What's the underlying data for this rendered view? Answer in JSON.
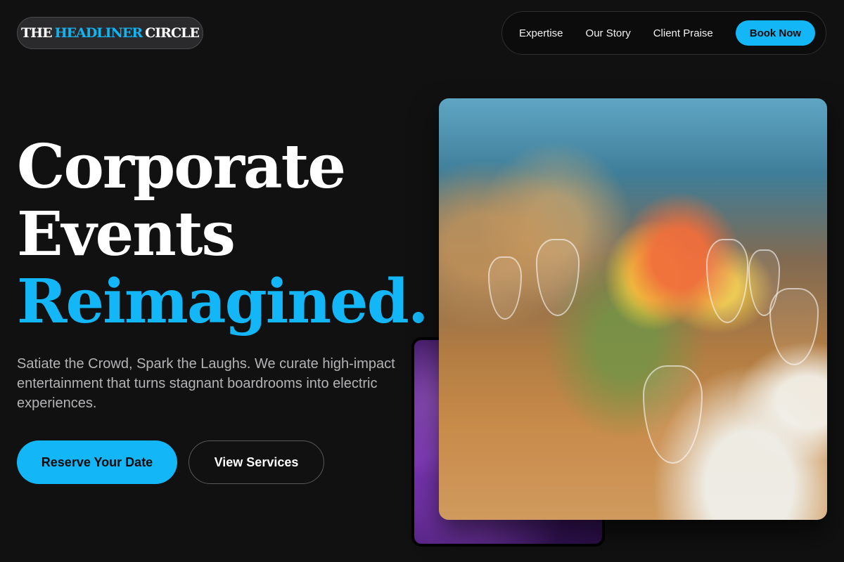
{
  "logo": {
    "part1": "THE",
    "part2": "HEADLINER",
    "part3": "CIRCLE"
  },
  "nav": {
    "items": [
      {
        "label": "Expertise"
      },
      {
        "label": "Our Story"
      },
      {
        "label": "Client Praise"
      }
    ],
    "cta": "Book Now"
  },
  "hero": {
    "line1": "Corporate",
    "line2": "Events",
    "line3": "Reimagined.",
    "subtitle": "Satiate the Crowd, Spark the Laughs. We curate high-impact entertainment that turns stagnant boardrooms into electric experiences.",
    "primary_button": "Reserve Your Date",
    "secondary_button": "View Services"
  },
  "colors": {
    "background": "#111112",
    "accent": "#13b6f6",
    "text": "#ffffff",
    "muted_text": "#b4b4b6"
  }
}
